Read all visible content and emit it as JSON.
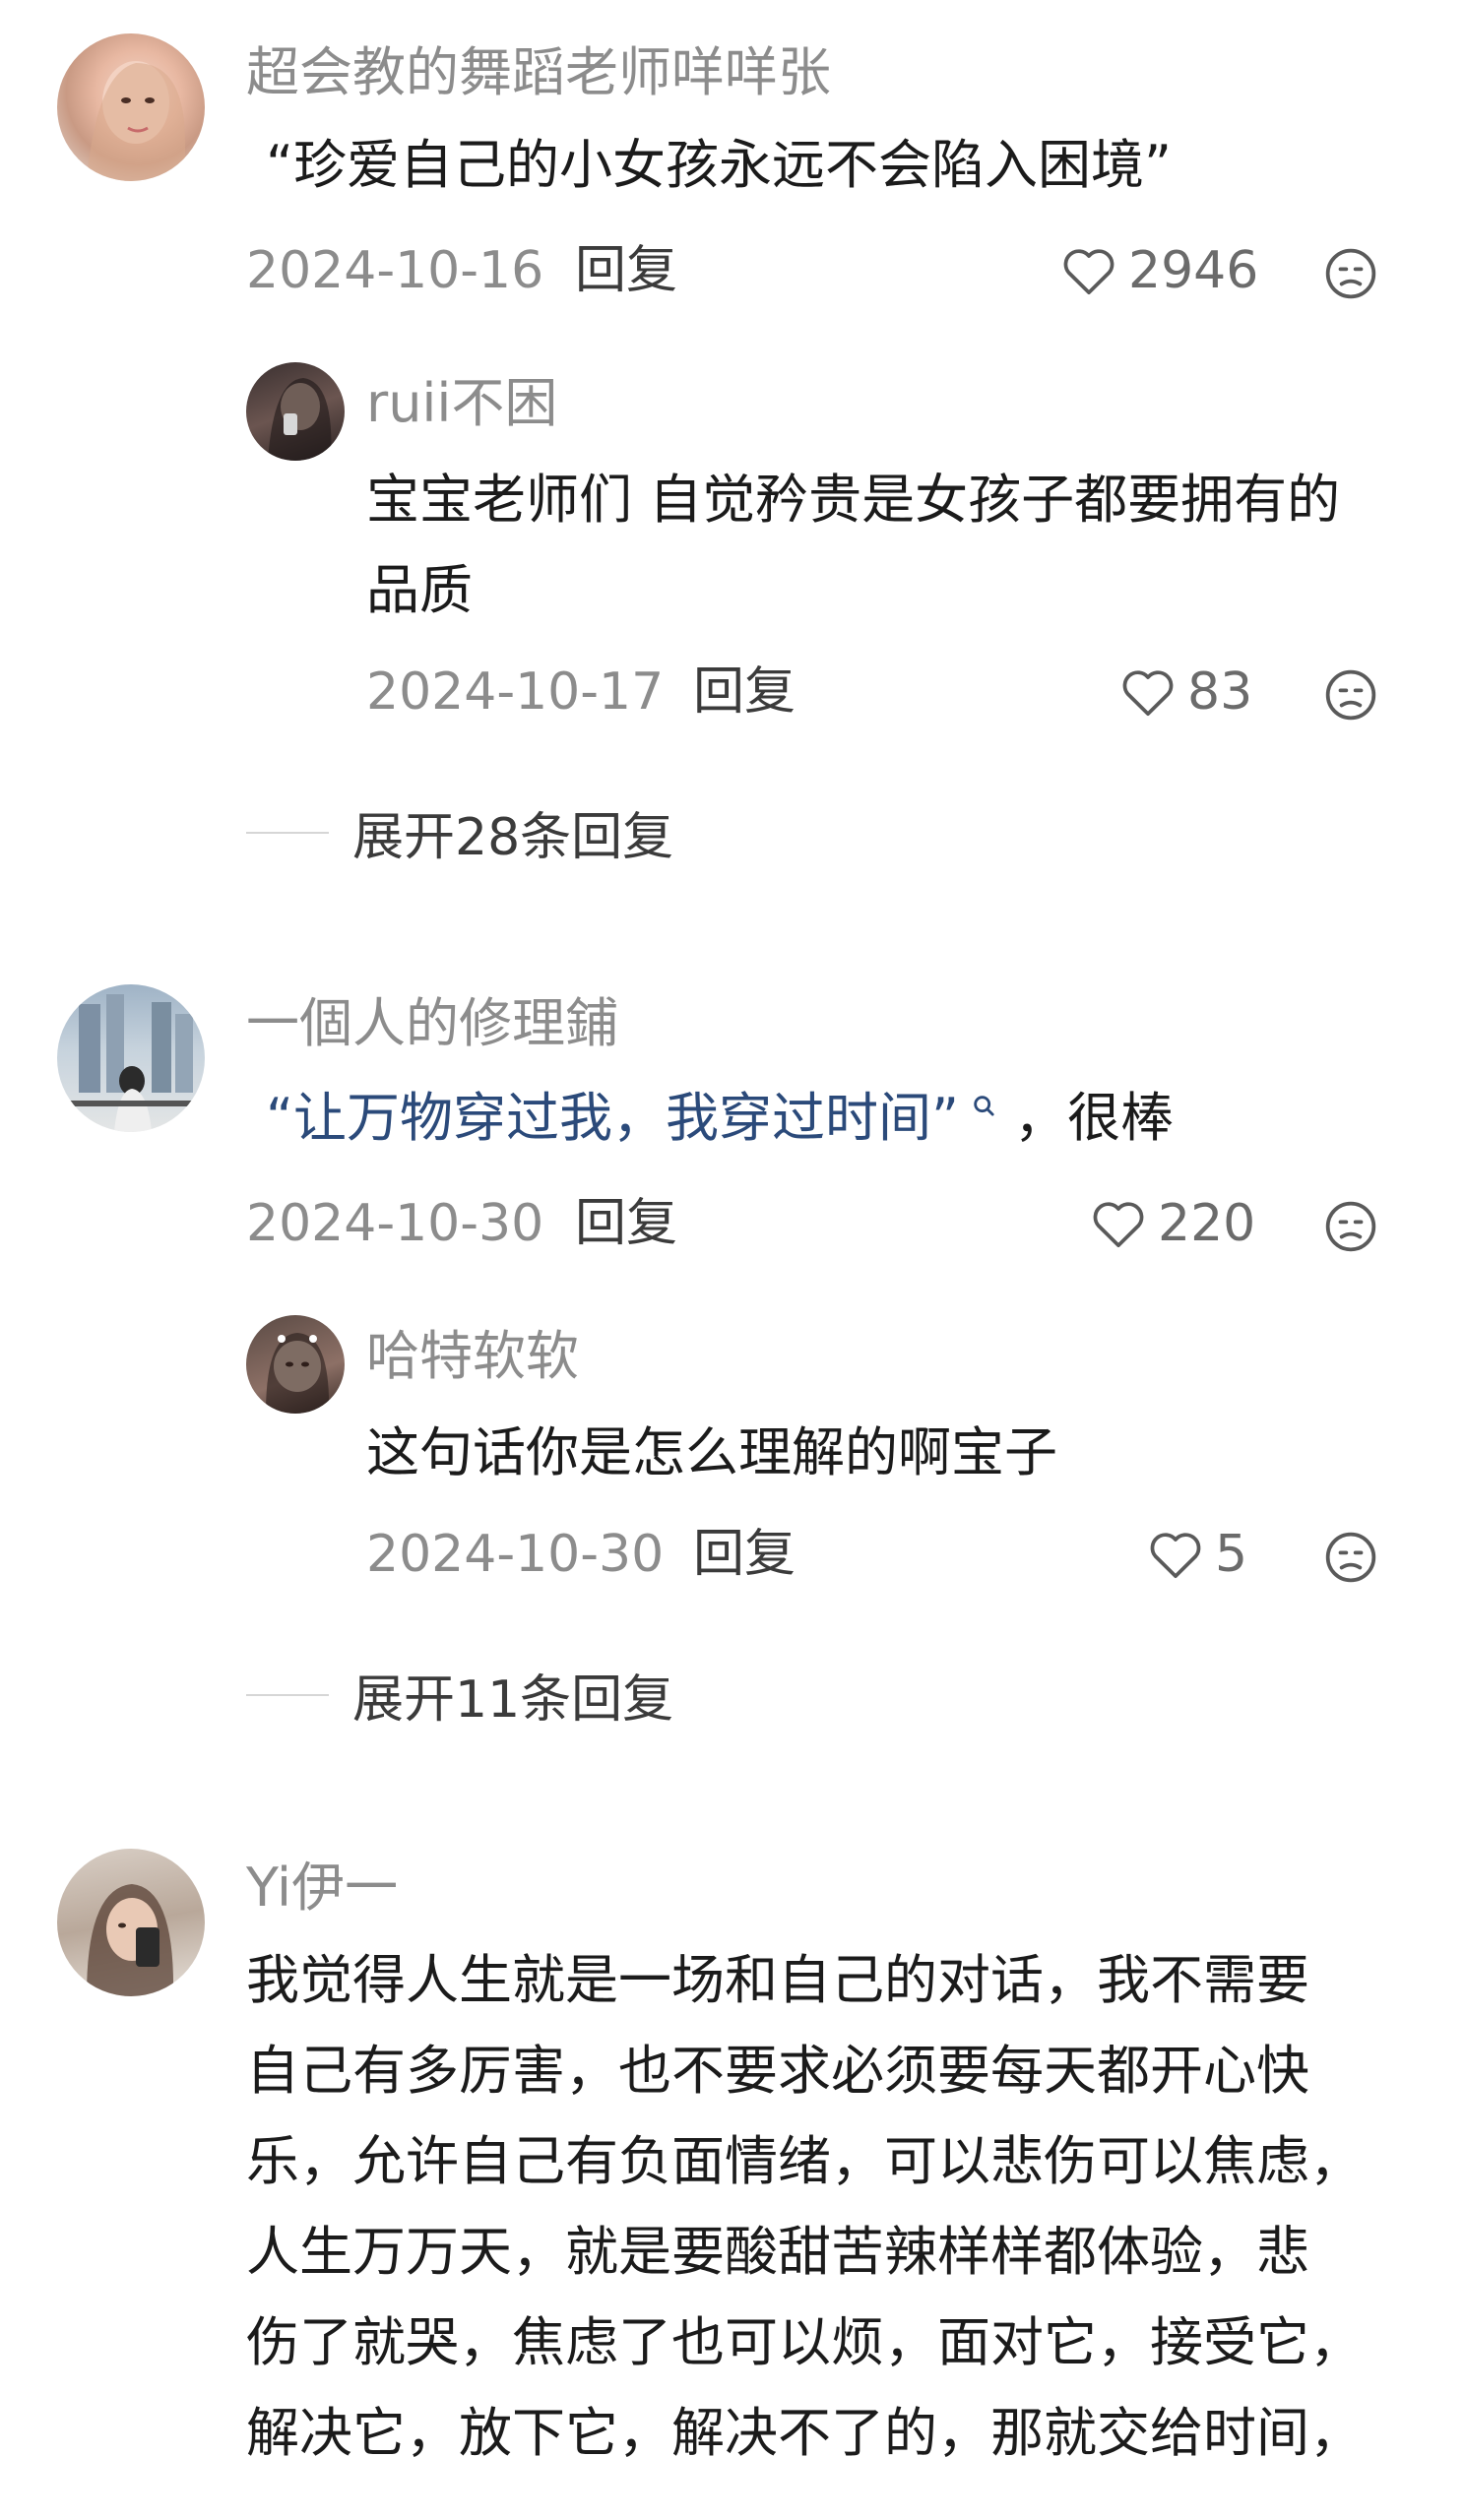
{
  "comments": [
    {
      "author": "超会教的舞蹈老师咩咩张",
      "text": "“珍爱自己的小女孩永远不会陷入困境”",
      "date": "2024-10-16",
      "reply_label": "回复",
      "likes": "2946",
      "replies": [
        {
          "author": "ruii不困",
          "text_lines": [
            "宝宝老师们 自觉矜贵是女孩子都要拥有的",
            "品质"
          ],
          "date": "2024-10-17",
          "reply_label": "回复",
          "likes": "83"
        }
      ],
      "expand_label": "展开28条回复"
    },
    {
      "author": "一個人的修理鋪",
      "text_link": "“让万物穿过我，我穿过时间”",
      "text_rest": "，很棒",
      "date": "2024-10-30",
      "reply_label": "回复",
      "likes": "220",
      "replies": [
        {
          "author": "哈特软软",
          "text_lines": [
            "这句话你是怎么理解的啊宝子"
          ],
          "date": "2024-10-30",
          "reply_label": "回复",
          "likes": "5"
        }
      ],
      "expand_label": "展开11条回复"
    },
    {
      "author": "Yi伊一",
      "text_lines": [
        "我觉得人生就是一场和自己的对话，我不需要",
        "自己有多厉害，也不要求必须要每天都开心快",
        "乐，允许自己有负面情绪，可以悲伤可以焦虑，",
        "人生万万天，就是要酸甜苦辣样样都体验，悲",
        "伤了就哭，焦虑了也可以烦，面对它，接受它，",
        "解决它，放下它，解决不了的，那就交给时间，"
      ]
    }
  ],
  "icons": {
    "like": "heart-outline-icon",
    "dislike": "sad-face-icon",
    "search": "search-icon"
  }
}
